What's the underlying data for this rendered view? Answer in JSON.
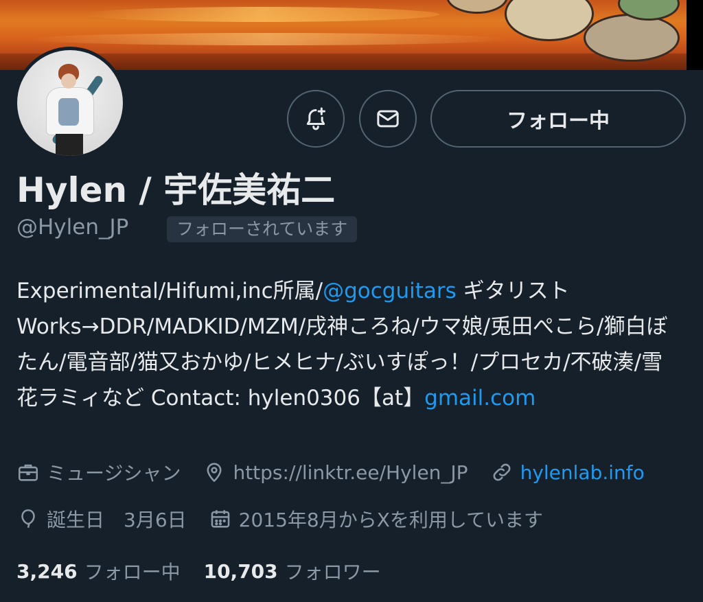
{
  "profile": {
    "display_name": "Hylen / 宇佐美祐二",
    "handle": "@Hylen_JP",
    "follows_you_badge": "フォローされています",
    "follow_button_label": "フォロー中",
    "bio": {
      "segment1": "Experimental/Hifumi,inc所属/",
      "mention": "@gocguitars",
      "segment2": " ギタリスト Works→DDR/MADKID/MZM/戌神ころね/ウマ娘/兎田ぺこら/獅白ぼたん/電音部/猫又おかゆ/ヒメヒナ/ぶいすぽっ！/プロセカ/不破湊/雪花ラミィなど Contact: hylen0306【at】",
      "link_tail": "gmail.com"
    },
    "category": "ミュージシャン",
    "location": "https://linktr.ee/Hylen_JP",
    "website": "hylenlab.info",
    "birthday": "誕生日　3月6日",
    "joined": "2015年8月からXを利用しています",
    "following_count": "3,246",
    "following_label": "フォロー中",
    "followers_count": "10,703",
    "followers_label": "フォロワー"
  },
  "icons": {
    "notify": "bell-plus-icon",
    "message": "envelope-icon",
    "category": "briefcase-icon",
    "location": "map-pin-icon",
    "website": "link-icon",
    "birthday": "balloon-icon",
    "joined": "calendar-icon"
  },
  "colors": {
    "background": "#15202b",
    "accent": "#1d9bf0",
    "muted": "#8b98a5"
  }
}
